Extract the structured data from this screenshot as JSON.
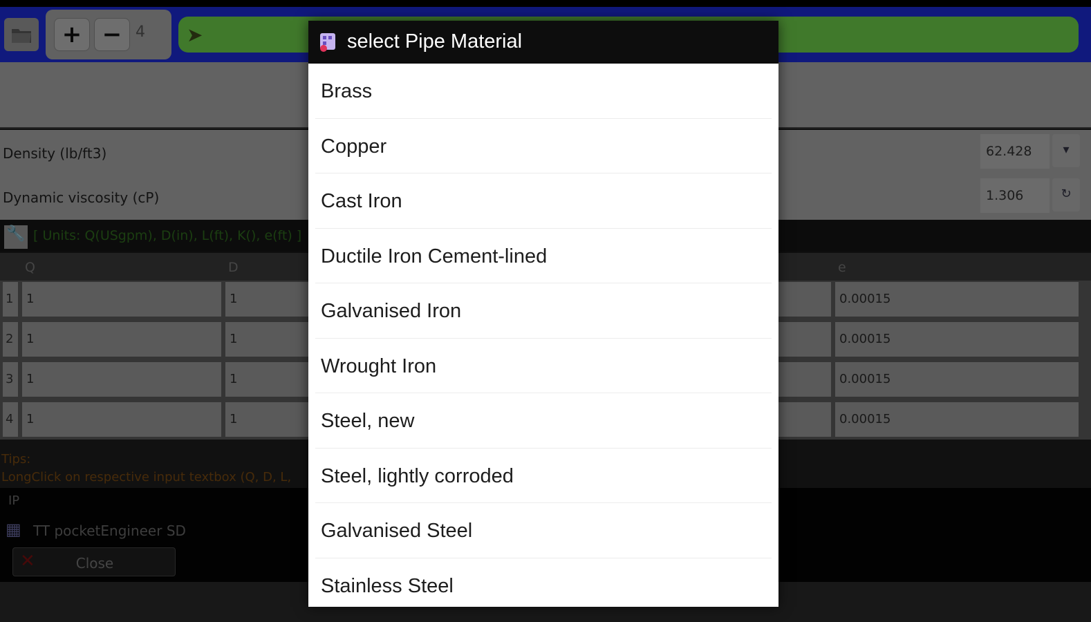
{
  "toolbar": {
    "plus_label": "+",
    "minus_label": "−",
    "count": "4"
  },
  "properties": [
    {
      "label": "Density (lb/ft3)",
      "value": "62.428",
      "button": "▾"
    },
    {
      "label": "Dynamic viscosity (cP)",
      "value": "1.306",
      "button": "↻"
    }
  ],
  "units_text": "[ Units: Q(USgpm), D(in), L(ft), K(), e(ft) ]",
  "grid": {
    "columns": [
      "Q",
      "D",
      "e"
    ],
    "rows": [
      {
        "num": "1",
        "q": "1",
        "d": "1",
        "e": "0.00015"
      },
      {
        "num": "2",
        "q": "1",
        "d": "1",
        "e": "0.00015"
      },
      {
        "num": "3",
        "q": "1",
        "d": "1",
        "e": "0.00015"
      },
      {
        "num": "4",
        "q": "1",
        "d": "1",
        "e": "0.00015"
      }
    ]
  },
  "tips": {
    "title": "Tips:",
    "text": "LongClick on respective input textbox (Q, D, L,"
  },
  "footer": {
    "ip_label": "IP",
    "app_name": "TT pocketEngineer SD",
    "close_label": "Close"
  },
  "dialog": {
    "title": "select Pipe Material",
    "items": [
      "Brass",
      "Copper",
      "Cast Iron",
      "Ductile Iron Cement-lined",
      "Galvanised Iron",
      "Wrought Iron",
      "Steel, new",
      "Steel, lightly corroded",
      "Galvanised Steel",
      "Stainless Steel"
    ]
  },
  "colors": {
    "toolbar": "#1c2bd8",
    "run_bar": "#6fd04a",
    "dialog_title_bg": "#0d0d0d",
    "dialog_bg": "#ffffff"
  }
}
